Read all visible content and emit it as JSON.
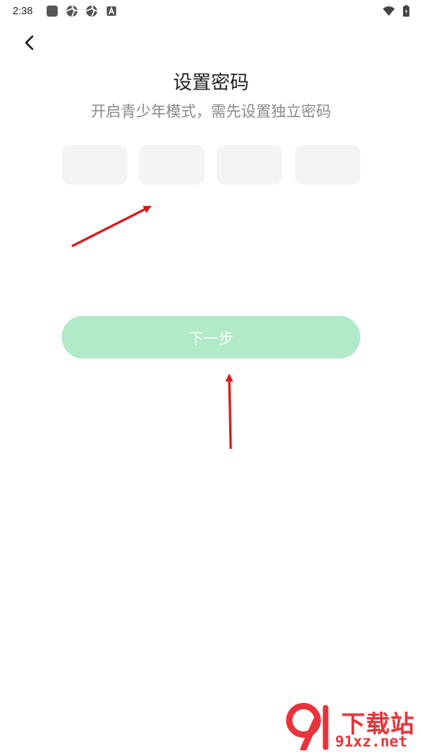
{
  "status_bar": {
    "time": "2:38",
    "left_icons": [
      "app-square-icon",
      "aperture-icon",
      "aperture-icon",
      "a-badge-icon"
    ],
    "right_icons": [
      "wifi-icon",
      "battery-charging-icon"
    ]
  },
  "nav": {
    "back_icon": "chevron-left-icon"
  },
  "page": {
    "title": "设置密码",
    "subtitle": "开启青少年模式，需先设置独立密码"
  },
  "pin": {
    "box_count": 4,
    "digits": [
      "",
      "",
      "",
      ""
    ]
  },
  "next_button": {
    "label": "下一步",
    "enabled": false
  },
  "annotations": {
    "arrow_color": "#d91a1a",
    "arrows": [
      "pointing-to-pin-input",
      "pointing-to-next-button"
    ]
  },
  "watermark": {
    "title": "下载站",
    "url": "91xz.net",
    "color": "#e8333a"
  },
  "colors": {
    "pin_box": "#f4f4f4",
    "button_disabled": "#b1eac8",
    "subtitle": "#8a8a8a"
  }
}
